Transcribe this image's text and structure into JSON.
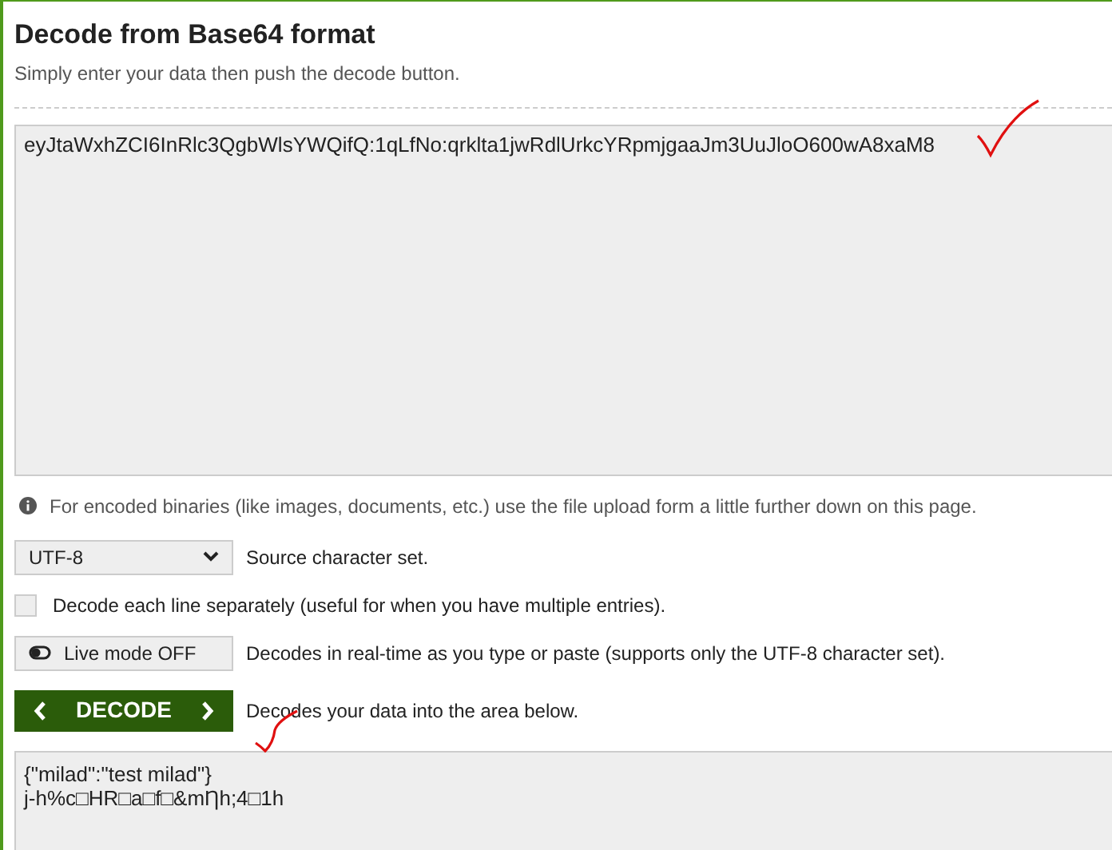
{
  "title": "Decode from Base64 format",
  "subtitle": "Simply enter your data then push the decode button.",
  "input": {
    "value": "eyJtaWxhZCI6InRlc3QgbWlsYWQifQ:1qLfNo:qrklta1jwRdlUrkcYRpmjgaaJm3UuJloO600wA8xaM8"
  },
  "info": "For encoded binaries (like images, documents, etc.) use the file upload form a little further down on this page.",
  "charset": {
    "value": "UTF-8",
    "label": "Source character set."
  },
  "line_option": {
    "label": "Decode each line separately (useful for when you have multiple entries).",
    "checked": false
  },
  "live_mode": {
    "label": "Live mode OFF",
    "on": false,
    "description": "Decodes in real-time as you type or paste (supports only the UTF-8 character set)."
  },
  "decode": {
    "label": "DECODE",
    "description": "Decodes your data into the area below."
  },
  "output": {
    "lines": [
      "{\"milad\":\"test milad\"}",
      "j-h%c□HR□a□f□&mȠh;4□1h"
    ]
  }
}
